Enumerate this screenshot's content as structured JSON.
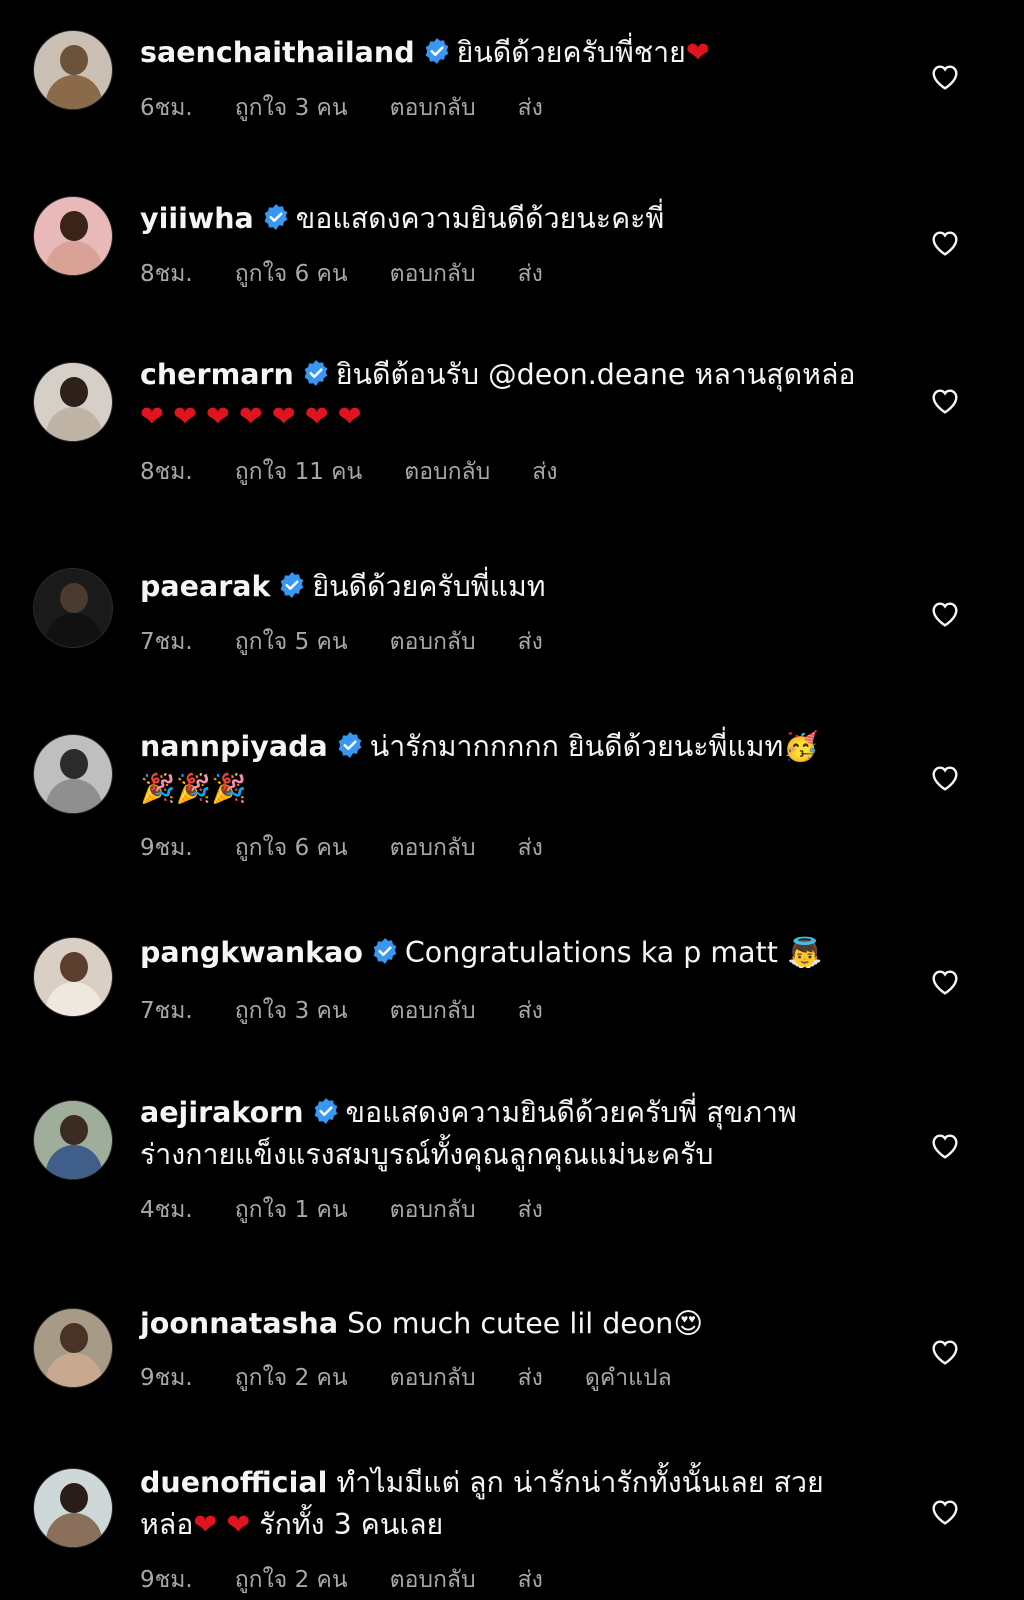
{
  "comments": [
    {
      "username": "saenchaithailand",
      "text": "ยินดีด้วยครับพี่ชาย",
      "emoji": "❤",
      "time": "6ชม.",
      "likes": "ถูกใจ 3 คน",
      "reply": "ตอบกลับ",
      "send": "ส่ง"
    },
    {
      "username": "yiiiwha",
      "text": "ขอแสดงความยินดีด้วยนะคะพี่",
      "time": "8ชม.",
      "likes": "ถูกใจ 6 คน",
      "reply": "ตอบกลับ",
      "send": "ส่ง"
    },
    {
      "username": "chermarn",
      "text": "ยินดีต้อนรับ @deon.deane  หลานสุดหล่อ",
      "emoji": "❤ ❤ ❤ ❤ ❤ ❤ ❤",
      "time": "8ชม.",
      "likes": "ถูกใจ 11 คน",
      "reply": "ตอบกลับ",
      "send": "ส่ง"
    },
    {
      "username": "paearak",
      "text": "ยินดีด้วยครับพี่แมท",
      "time": "7ชม.",
      "likes": "ถูกใจ 5 คน",
      "reply": "ตอบกลับ",
      "send": "ส่ง"
    },
    {
      "username": "nannpiyada",
      "text": "น่ารักมากกกกก ยินดีด้วยนะพี่แมท",
      "emoji": "🥳 🎉🎉🎉",
      "time": "9ชม.",
      "likes": "ถูกใจ 6 คน",
      "reply": "ตอบกลับ",
      "send": "ส่ง"
    },
    {
      "username": "pangkwankao",
      "text": "Congratulations ka p matt",
      "emoji": "👼",
      "time": "7ชม.",
      "likes": "ถูกใจ 3 คน",
      "reply": "ตอบกลับ",
      "send": "ส่ง"
    },
    {
      "username": "aejirakorn",
      "text": "ขอแสดงความยินดีด้วยครับพี่ สุขภาพร่างกายแข็งแรงสมบูรณ์ทั้งคุณลูกคุณแม่นะครับ",
      "time": "4ชม.",
      "likes": "ถูกใจ 1 คน",
      "reply": "ตอบกลับ",
      "send": "ส่ง"
    },
    {
      "username": "joonnatasha",
      "text": "So much cutee lil deon",
      "emoji": "😍",
      "time": "9ชม.",
      "likes": "ถูกใจ 2 คน",
      "reply": "ตอบกลับ",
      "send": "ส่ง",
      "translate": "ดูคำแปล"
    },
    {
      "username": "duenofficial",
      "text": "ทำไมมีแต่ ลูก น่ารักน่ารักทั้งนั้นเลย สวยหล่อ",
      "emoji": "❤ ❤",
      "text2": "รักทั้ง 3 คนเลย",
      "time": "9ชม.",
      "likes": "ถูกใจ 2 คน",
      "reply": "ตอบกลับ",
      "send": "ส่ง"
    }
  ],
  "icons": {
    "verified": "verified-badge-icon",
    "like": "heart-outline-icon"
  },
  "colors": {
    "background": "#000000",
    "text": "#f5f5f5",
    "meta": "#a8a8a8",
    "verified": "#3897f0",
    "heart_emoji": "#e0141e"
  }
}
